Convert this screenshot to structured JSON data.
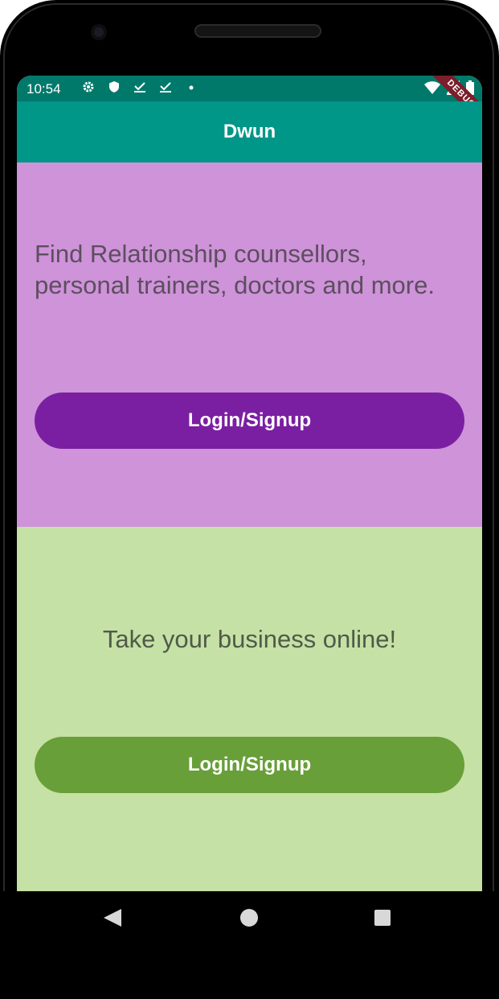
{
  "status_bar": {
    "time": "10:54",
    "icons": [
      "gear-icon",
      "shield-icon",
      "download-done-icon",
      "download-done-icon",
      "dot-icon",
      "wifi-icon",
      "signal-icon",
      "battery-icon"
    ],
    "debug_banner": "DEBUG",
    "color": "#00796b"
  },
  "app_bar": {
    "title": "Dwun",
    "color": "#009688"
  },
  "sections": {
    "top": {
      "text": "Find Relationship counsellors, personal trainers, doctors and more.",
      "button_label": "Login/Signup",
      "background": "#ce93d8",
      "button_color": "#7b1fa2"
    },
    "bottom": {
      "text": "Take your business online!",
      "button_label": "Login/Signup",
      "background": "#c5e1a5",
      "button_color": "#689f38"
    }
  },
  "nav_bar": {
    "buttons": [
      "back-icon",
      "home-icon",
      "recents-icon"
    ]
  }
}
